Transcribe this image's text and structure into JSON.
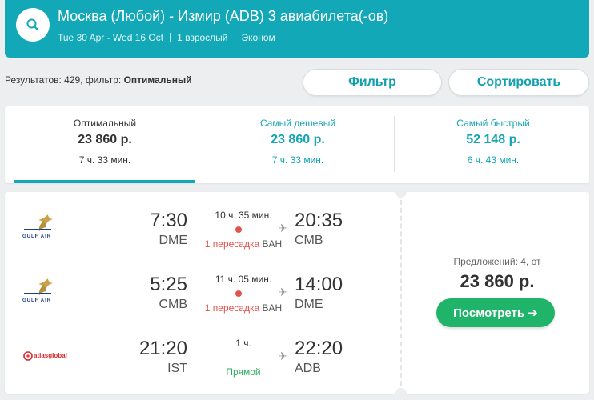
{
  "header": {
    "title": "Москва (Любой) - Измир (ADB) 3 авиабилета(-ов)",
    "dates": "Tue 30 Apr - Wed 16 Oct",
    "passengers": "1 взрослый",
    "cabin": "Эконом"
  },
  "results": {
    "prefix": "Результатов: 429, фильтр: ",
    "filter_value": "Оптимальный"
  },
  "buttons": {
    "filter": "Фильтр",
    "sort": "Сортировать",
    "view": "Посмотреть ➔"
  },
  "tabs": [
    {
      "label": "Оптимальный",
      "price": "23 860 р.",
      "duration": "7 ч. 33 мин."
    },
    {
      "label": "Самый дешевый",
      "price": "23 860 р.",
      "duration": "7 ч. 33 мин."
    },
    {
      "label": "Самый быстрый",
      "price": "52 148 р.",
      "duration": "6 ч. 43 мин."
    }
  ],
  "legs": [
    {
      "airline": "Gulf Air",
      "logo_text": "GULF AIR",
      "dep_time": "7:30",
      "dep_code": "DME",
      "duration": "10 ч. 35 мин.",
      "stops": "1 пересадка",
      "via": "BAH",
      "arr_time": "20:35",
      "arr_code": "CMB"
    },
    {
      "airline": "Gulf Air",
      "logo_text": "GULF AIR",
      "dep_time": "5:25",
      "dep_code": "CMB",
      "duration": "11 ч. 05 мин.",
      "stops": "1 пересадка",
      "via": "BAH",
      "arr_time": "14:00",
      "arr_code": "DME"
    },
    {
      "airline": "AtlasGlobal",
      "logo_text": "atlasglobal",
      "dep_time": "21:20",
      "dep_code": "IST",
      "duration": "1 ч.",
      "stops": "Прямой",
      "via": "",
      "arr_time": "22:20",
      "arr_code": "ADB"
    }
  ],
  "offer": {
    "label": "Предложений: 4, от",
    "price": "23 860 р."
  },
  "colors": {
    "primary": "#12a8b7",
    "accent_text": "#13a5b3",
    "stop_red": "#e0544b",
    "direct_green": "#2fae61",
    "button_green": "#1fb46a"
  }
}
